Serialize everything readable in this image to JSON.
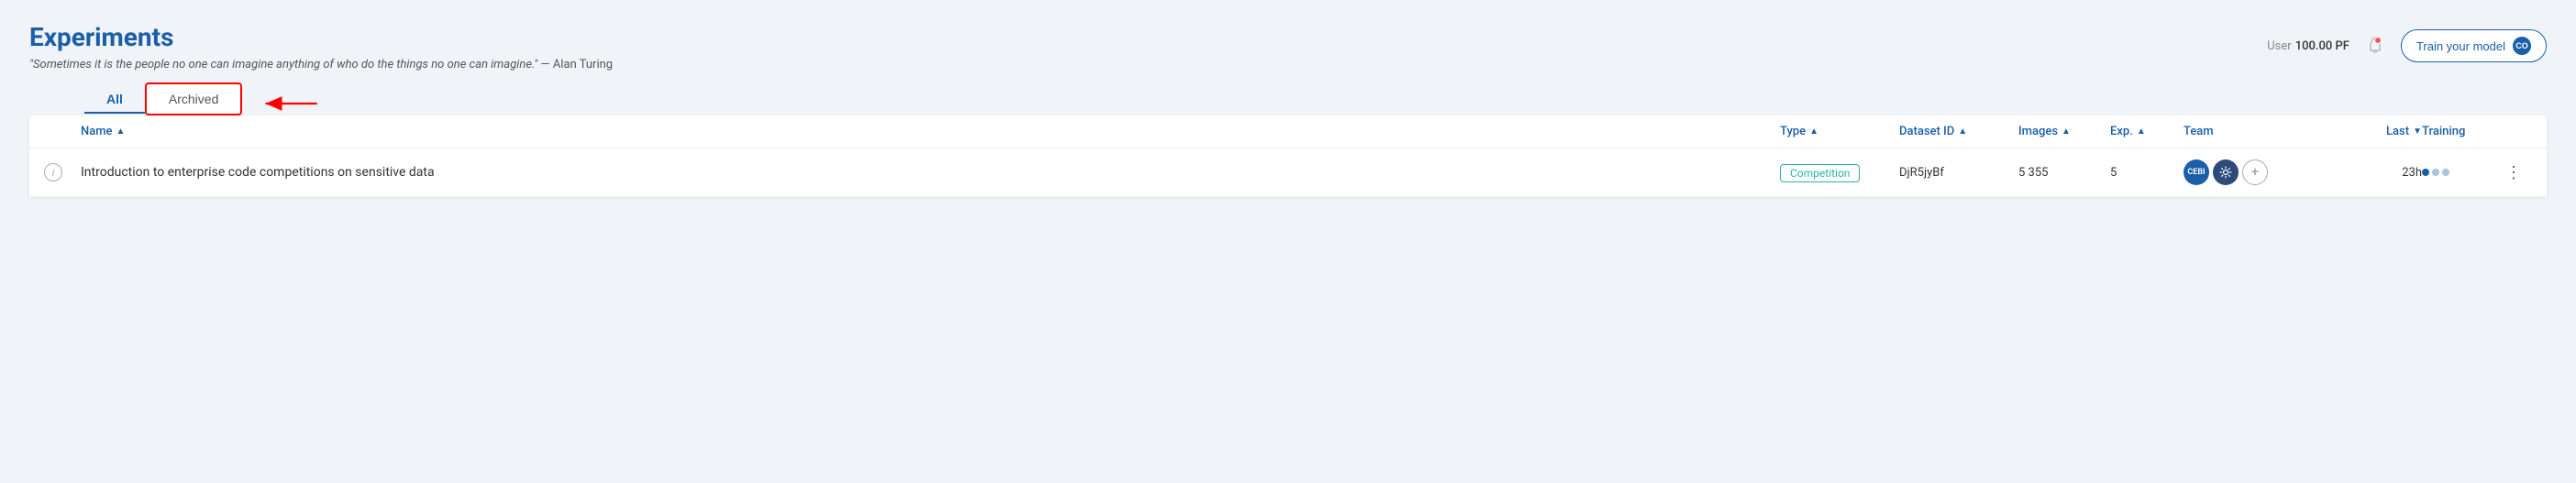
{
  "page": {
    "title": "Experiments",
    "quote": "\"Sometimes it is the people no one can imagine anything of who do the things no one can imagine.\"",
    "quote_author": "— Alan Turing",
    "user_label": "User",
    "user_pf": "100.00 PF",
    "train_button": "Train your model",
    "train_logo": "CO"
  },
  "tabs": [
    {
      "label": "All",
      "active": true
    },
    {
      "label": "Archived",
      "active": false
    }
  ],
  "table": {
    "columns": [
      {
        "label": "",
        "sort": false
      },
      {
        "label": "Name",
        "sort": "asc"
      },
      {
        "label": "Type",
        "sort": "asc"
      },
      {
        "label": "Dataset ID",
        "sort": "asc"
      },
      {
        "label": "Images",
        "sort": "asc"
      },
      {
        "label": "Exp.",
        "sort": "asc"
      },
      {
        "label": "Team",
        "sort": false
      },
      {
        "label": "Last",
        "sort": "desc"
      },
      {
        "label": "Training",
        "sort": false
      },
      {
        "label": "",
        "sort": false
      }
    ],
    "rows": [
      {
        "name": "Introduction to enterprise code competitions on sensitive data",
        "type": "Competition",
        "dataset_id": "DjR5jyBf",
        "images": "5 355",
        "exp": "5",
        "team": [
          "CEBI",
          "gear",
          "+"
        ],
        "last": "23h",
        "training": "dots"
      }
    ]
  }
}
